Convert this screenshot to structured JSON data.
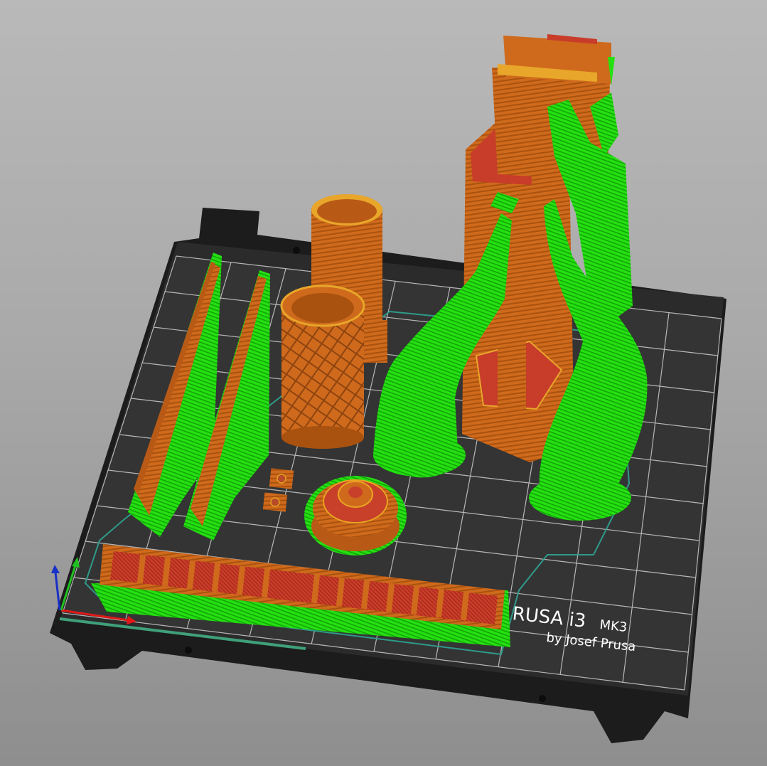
{
  "viewer": {
    "bed_brand_line1": "RUSA i3",
    "bed_brand_line1_suffix": "MK3",
    "bed_brand_line2": "by Josef Prusa"
  },
  "colors": {
    "background_top": "#b9b9b9",
    "background_bottom": "#8e8e8e",
    "bed_plate": "#2b2b2b",
    "bed_frame": "#1c1c1c",
    "grid_line": "#d8d8d8",
    "perimeter_orange": "#d2691e",
    "infill_red": "#c83c2a",
    "support_green": "#22dd10",
    "skirt_teal": "#2f9a8a",
    "axis_x": "#e01818",
    "axis_y": "#20c020",
    "axis_z": "#1830c8"
  },
  "legend_icons": [
    "bed-plate-icon",
    "axes-gizmo-icon"
  ]
}
